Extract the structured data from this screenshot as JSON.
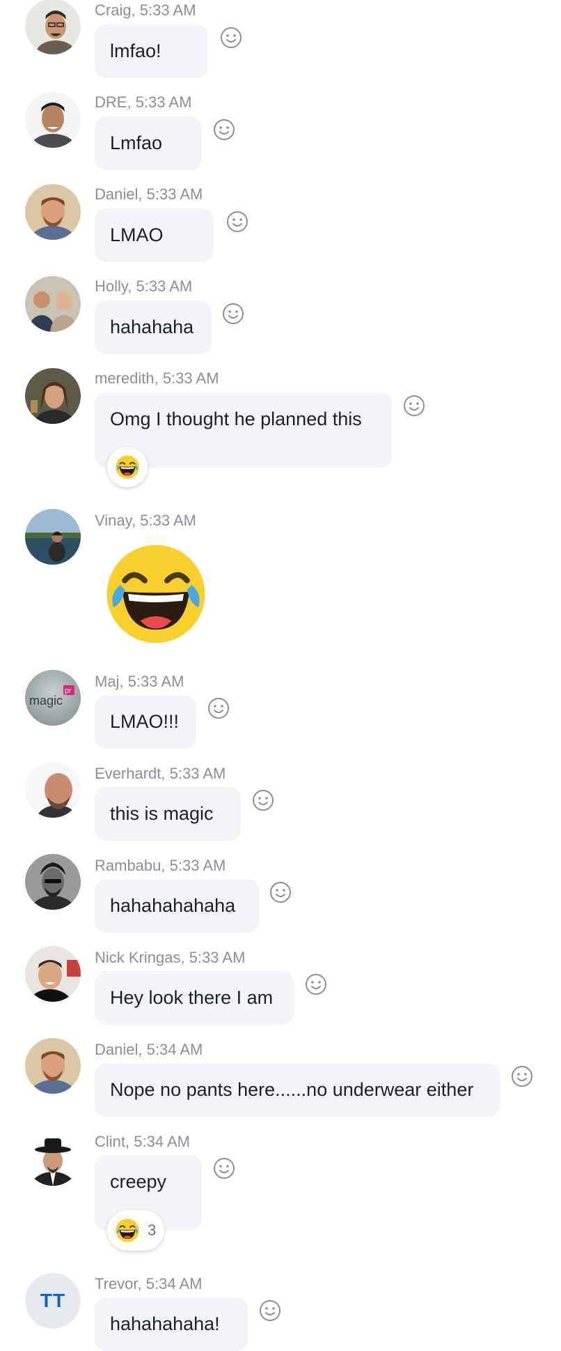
{
  "messages": [
    {
      "id": "craig",
      "author": "Craig",
      "time": "5:33 AM",
      "text": "lmfao!"
    },
    {
      "id": "dre",
      "author": "DRE",
      "time": "5:33 AM",
      "text": "Lmfao"
    },
    {
      "id": "daniel1",
      "author": "Daniel",
      "time": "5:33 AM",
      "text": "LMAO"
    },
    {
      "id": "holly",
      "author": "Holly",
      "time": "5:33 AM",
      "text": "hahahaha"
    },
    {
      "id": "meredith",
      "author": "meredith",
      "time": "5:33 AM",
      "text": "Omg I thought he planned this",
      "reaction": {
        "emoji": "laughing-tears-emoji",
        "count": ""
      }
    },
    {
      "id": "vinay",
      "author": "Vinay",
      "time": "5:33 AM",
      "emoji": "laughing-tears-emoji"
    },
    {
      "id": "maj",
      "author": "Maj",
      "time": "5:33 AM",
      "text": "LMAO!!!",
      "avatar_logo": {
        "word": "magic",
        "badge": "pr"
      }
    },
    {
      "id": "everhardt",
      "author": "Everhardt",
      "time": "5:33 AM",
      "text": "this is magic"
    },
    {
      "id": "rambabu",
      "author": "Rambabu",
      "time": "5:33 AM",
      "text": "hahahahahaha"
    },
    {
      "id": "nick",
      "author": "Nick Kringas",
      "time": "5:33 AM",
      "text": "Hey look there I am"
    },
    {
      "id": "daniel2",
      "author": "Daniel",
      "time": "5:34 AM",
      "text": "Nope no pants here......no underwear either"
    },
    {
      "id": "clint",
      "author": "Clint",
      "time": "5:34 AM",
      "text": "creepy",
      "reaction": {
        "emoji": "laughing-tears-emoji",
        "count": "3"
      }
    },
    {
      "id": "trevor",
      "author": "Trevor",
      "time": "5:34 AM",
      "text": "hahahahaha!",
      "avatar_initials": "TT"
    }
  ],
  "icons": {
    "add_reaction": "smiley-outline-icon"
  },
  "colors": {
    "bubble": "#f2f4f7",
    "meta_text": "#8a8f96",
    "initials": "#1565c0",
    "emoji_face": "#f7cf2e"
  }
}
